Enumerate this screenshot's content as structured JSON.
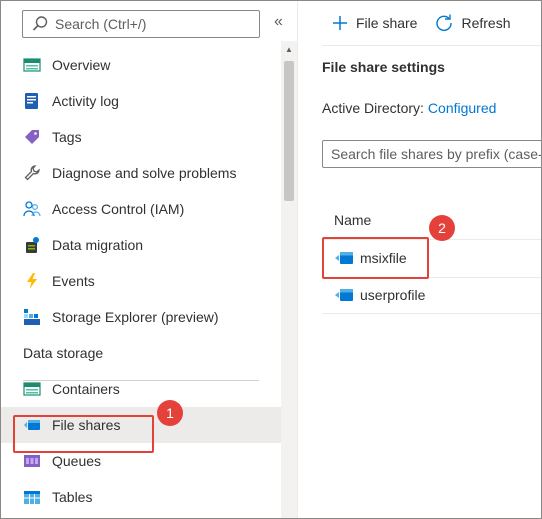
{
  "sidebar": {
    "search_placeholder": "Search (Ctrl+/)",
    "collapse_label": "«",
    "items": [
      {
        "label": "Overview",
        "icon": "overview-icon"
      },
      {
        "label": "Activity log",
        "icon": "activity-log-icon"
      },
      {
        "label": "Tags",
        "icon": "tag-icon"
      },
      {
        "label": "Diagnose and solve problems",
        "icon": "wrench-icon"
      },
      {
        "label": "Access Control (IAM)",
        "icon": "people-icon"
      },
      {
        "label": "Data migration",
        "icon": "data-migration-icon"
      },
      {
        "label": "Events",
        "icon": "lightning-icon"
      },
      {
        "label": "Storage Explorer (preview)",
        "icon": "storage-explorer-icon"
      }
    ],
    "section_title": "Data storage",
    "data_storage_items": [
      {
        "label": "Containers",
        "icon": "containers-icon"
      },
      {
        "label": "File shares",
        "icon": "file-share-icon",
        "selected": true
      },
      {
        "label": "Queues",
        "icon": "queues-icon"
      },
      {
        "label": "Tables",
        "icon": "tables-icon"
      }
    ]
  },
  "toolbar": {
    "add_label": "File share",
    "refresh_label": "Refresh"
  },
  "main": {
    "settings_title": "File share settings",
    "ad_label": "Active Directory:",
    "ad_value": "Configured",
    "search_placeholder": "Search file shares by prefix (case-sensitive)",
    "column_name": "Name",
    "shares": [
      "msixfile",
      "userprofile"
    ]
  },
  "callouts": {
    "one": "1",
    "two": "2"
  },
  "colors": {
    "accent": "#0078d4",
    "callout": "#e5413b"
  }
}
